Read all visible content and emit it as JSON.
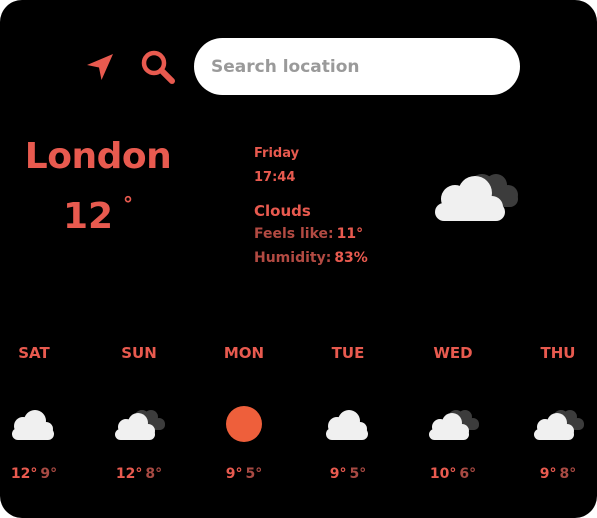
{
  "search": {
    "placeholder": "Search location",
    "value": ""
  },
  "current": {
    "city": "London",
    "temperature": "12",
    "degree_symbol": "°",
    "day": "Friday",
    "time": "17:44",
    "condition": "Clouds",
    "feels_like_label": "Feels like:",
    "feels_like_value": "11°",
    "humidity_label": "Humidity:",
    "humidity_value": "83%",
    "icon": "clouds-broken-icon"
  },
  "forecast": [
    {
      "day": "SAT",
      "high": "12°",
      "low": "9°",
      "icon": "cloud-icon"
    },
    {
      "day": "SUN",
      "high": "12°",
      "low": "8°",
      "icon": "clouds-broken-icon"
    },
    {
      "day": "MON",
      "high": "9°",
      "low": "5°",
      "icon": "sun-icon"
    },
    {
      "day": "TUE",
      "high": "9°",
      "low": "5°",
      "icon": "cloud-icon"
    },
    {
      "day": "WED",
      "high": "10°",
      "low": "6°",
      "icon": "clouds-broken-icon"
    },
    {
      "day": "THU",
      "high": "9°",
      "low": "8°",
      "icon": "clouds-broken-icon"
    }
  ],
  "colors": {
    "background": "#000000",
    "accent": "#e85a4f",
    "accent_dim": "#a84a43",
    "sun": "#ee5f3b",
    "cloud_front": "#f0f0f0",
    "cloud_back": "#3c3c3c"
  }
}
